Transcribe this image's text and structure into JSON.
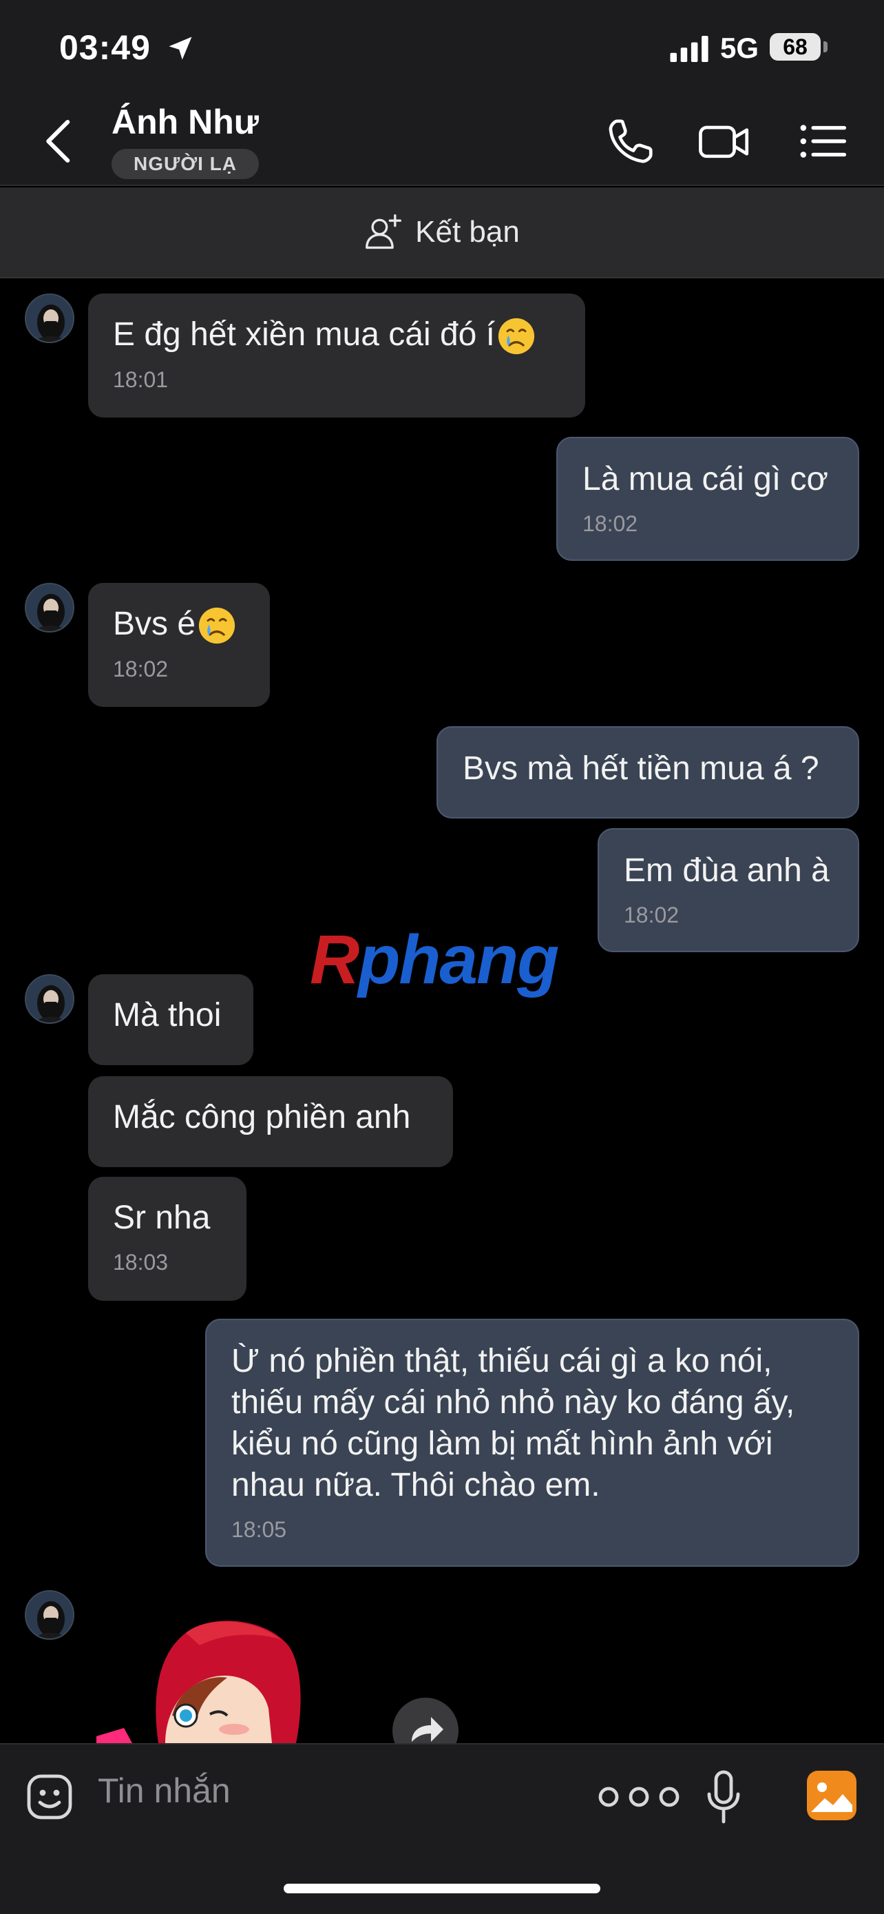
{
  "status_bar": {
    "time": "03:49",
    "network": "5G",
    "battery": "68"
  },
  "header": {
    "name": "Ánh Như",
    "badge": "NGƯỜI LẠ"
  },
  "add_friend": {
    "label": "Kết bạn"
  },
  "messages": [
    {
      "dir": "in",
      "text": "E đg hết xiền mua cái đó í",
      "emoji": "crying-face",
      "time": "18:01"
    },
    {
      "dir": "out",
      "text": "Là mua cái gì cơ",
      "time": "18:02"
    },
    {
      "dir": "in",
      "text": "Bvs é",
      "emoji": "crying-face",
      "time": "18:02"
    },
    {
      "dir": "out",
      "text": "Bvs mà hết tiền mua á ?"
    },
    {
      "dir": "out",
      "text": "Em đùa anh à",
      "time": "18:02"
    },
    {
      "dir": "in",
      "text": "Mà thoi"
    },
    {
      "dir": "in",
      "text": "Mắc công phiền anh"
    },
    {
      "dir": "in",
      "text": "Sr nha",
      "time": "18:03"
    },
    {
      "dir": "out",
      "lines": [
        "Ừ nó phiền thật, thiếu cái gì a ko nói,",
        "thiếu mấy cái nhỏ nhỏ này ko đáng ấy,",
        "kiểu nó cũng làm bị mất hình ảnh với",
        "nhau nữa. Thôi chào em."
      ],
      "time": "18:05"
    }
  ],
  "watermark": {
    "first": "R",
    "rest": "phang"
  },
  "input": {
    "placeholder": "Tin nhắn"
  },
  "colors": {
    "incoming": "#2c2c2e",
    "outgoing": "#3a4454",
    "accent": "#f08a1c",
    "background": "#000000"
  },
  "icons": [
    "back-icon",
    "phone-icon",
    "video-icon",
    "menu-icon",
    "add-friend-icon",
    "sticker-icon",
    "more-icon",
    "microphone-icon",
    "image-icon",
    "forward-icon"
  ]
}
